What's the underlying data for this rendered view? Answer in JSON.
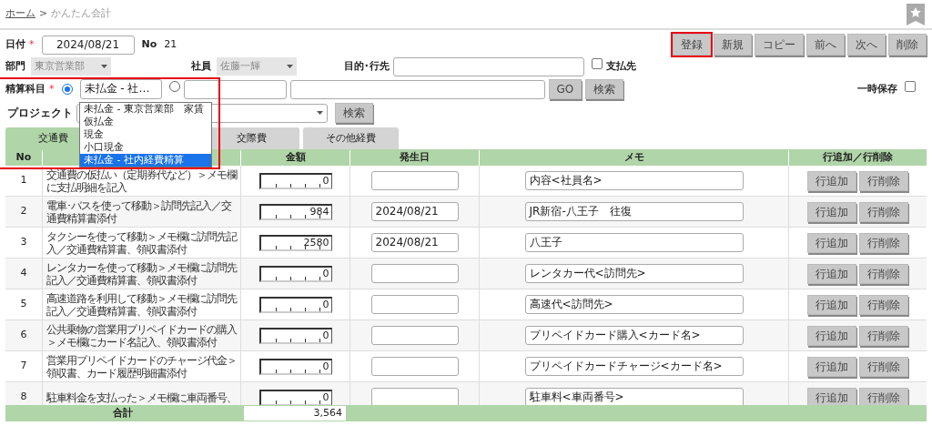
{
  "breadcrumb": {
    "home": "ホーム",
    "separator": ">",
    "current": "かんたん会計"
  },
  "form": {
    "date_label": "日付",
    "required_mark": "*",
    "date": "2024/08/21",
    "no_label": "No",
    "no": "21",
    "dept_label": "部門",
    "dept": "東京営業部",
    "employee_label": "社員",
    "employee": "佐藤一輝",
    "purpose_label": "目的･行先",
    "payee_label": "支払先",
    "payee_checked": false,
    "account_label": "精算科目",
    "account_required_mark": "*",
    "account_radio_selected": true,
    "other_radio_selected": false,
    "account_value": "未払金 - 社…",
    "go": "GO",
    "search": "検索",
    "project_label": "プロジェクト",
    "project_search": "検索",
    "temp_save_label": "一時保存",
    "temp_save_checked": false
  },
  "buttons": [
    {
      "label": "登録",
      "highlighted": true
    },
    {
      "label": "新規",
      "highlighted": false
    },
    {
      "label": "コピー",
      "highlighted": false
    },
    {
      "label": "前へ",
      "highlighted": false
    },
    {
      "label": "次へ",
      "highlighted": false
    },
    {
      "label": "削除",
      "highlighted": false
    }
  ],
  "dropdown_options": [
    {
      "label": "未払金 - 東京営業部　家賃",
      "selected": false
    },
    {
      "label": "仮払金",
      "selected": false
    },
    {
      "label": "現金",
      "selected": false
    },
    {
      "label": "小口現金",
      "selected": false
    },
    {
      "label": "未払金 - 社内経費精算",
      "selected": true
    }
  ],
  "tabs": [
    {
      "label": "交通費",
      "selected": true
    },
    {
      "label": "交際費",
      "selected": false
    },
    {
      "label": "その他経費",
      "selected": false
    }
  ],
  "table": {
    "columns": [
      "No",
      "金額",
      "発生日",
      "メモ",
      "行追加／行削除"
    ],
    "rows": [
      {
        "no": "1",
        "content": "交通費の仮払い（定期券代など）＞メモ欄に支払明細を記入",
        "amount": "0",
        "date": "",
        "memo": "内容<社員名>"
      },
      {
        "no": "2",
        "content": "電車･バスを使って移動＞訪問先記入／交通費精算書添付",
        "amount": "984",
        "date": "2024/08/21",
        "memo": "JR新宿-八王子　往復"
      },
      {
        "no": "3",
        "content": "タクシーを使って移動＞メモ欄に訪問先記入／交通費精算書、領収書添付",
        "amount": "2580",
        "date": "2024/08/21",
        "memo": "八王子"
      },
      {
        "no": "4",
        "content": "レンタカーを使って移動＞メモ欄に訪問先記入／交通費精算書、領収書添付",
        "amount": "0",
        "date": "",
        "memo": "レンタカー代<訪問先>"
      },
      {
        "no": "5",
        "content": "高速道路を利用して移動＞メモ欄に訪問先記入／交通費精算書、領収書添付",
        "amount": "0",
        "date": "",
        "memo": "高速代<訪問先>"
      },
      {
        "no": "6",
        "content": "公共乗物の営業用プリペイドカードの購入＞メモ欄にカード名記入、領収書添付",
        "amount": "0",
        "date": "",
        "memo": "プリペイドカード購入<カード名>"
      },
      {
        "no": "7",
        "content": "営業用プリペイドカードのチャージ代金＞領収書、カード履歴明細書添付",
        "amount": "0",
        "date": "",
        "memo": "プリペイドカードチャージ<カード名>"
      },
      {
        "no": "8",
        "content": "駐車料金を支払った＞メモ欄に車両番号、",
        "amount": "0",
        "date": "",
        "memo": "駐車料<車両番号>"
      }
    ],
    "row_buttons": [
      {
        "add": "行追加",
        "delete": "行削除"
      },
      {
        "add": "行追加",
        "delete": "行削除"
      },
      {
        "add": "行追加",
        "delete": "行削除"
      },
      {
        "add": "行追加",
        "delete": "行削除"
      },
      {
        "add": "行追加",
        "delete": "行削除"
      },
      {
        "add": "行追加",
        "delete": "行削除"
      },
      {
        "add": "行追加",
        "delete": "行削除"
      },
      {
        "add": "行追加",
        "delete": "行削除"
      }
    ],
    "total_label": "合計",
    "total": "3,564"
  }
}
